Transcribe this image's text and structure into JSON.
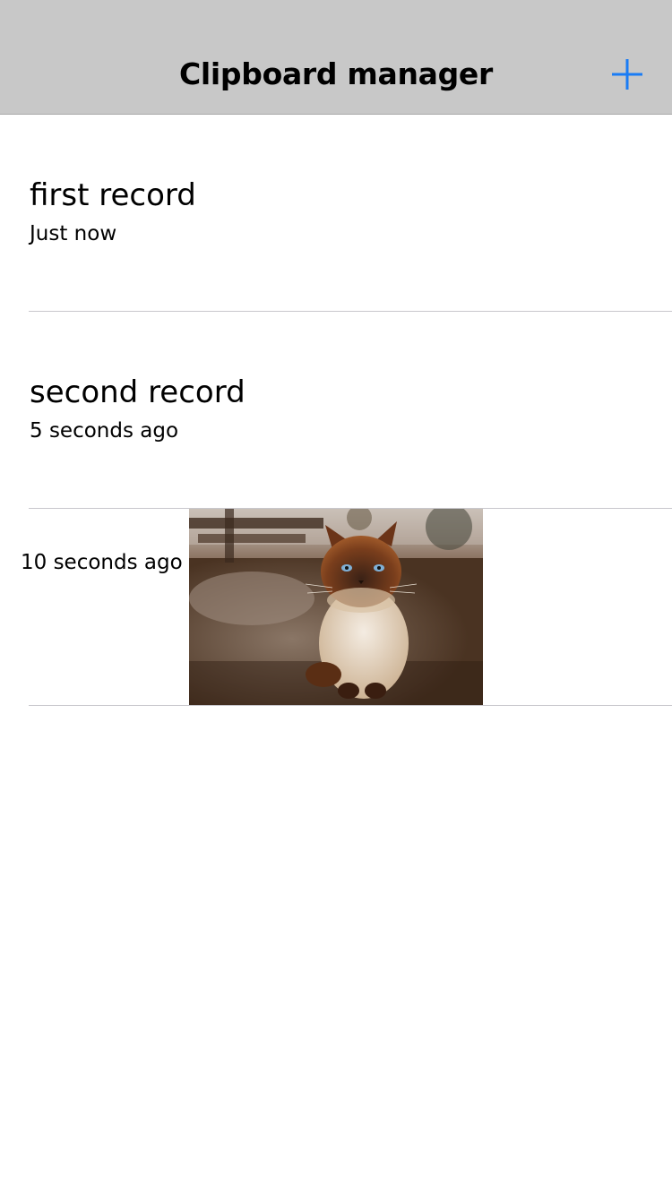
{
  "navbar": {
    "title": "Clipboard manager",
    "add_icon": "plus-icon",
    "accent_color": "#1a7cf5"
  },
  "records": [
    {
      "title": "first record",
      "time": "Just now"
    },
    {
      "title": "second record",
      "time": "5 seconds ago"
    },
    {
      "type": "image",
      "image": "cat-photo",
      "time": "10 seconds ago"
    }
  ]
}
